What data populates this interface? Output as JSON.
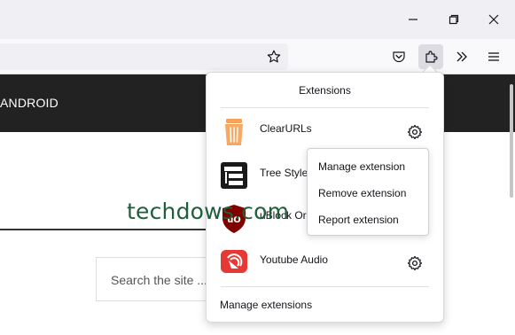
{
  "window": {
    "minimize_icon": "minimize-icon",
    "maximize_icon": "restore-icon",
    "close_icon": "close-icon"
  },
  "toolbar": {
    "bookmark_icon": "star-icon",
    "pocket_icon": "pocket-icon",
    "extensions_icon": "puzzle-icon",
    "overflow_icon": "double-chevron-icon",
    "menu_icon": "hamburger-icon"
  },
  "site": {
    "nav_item": "ANDROID",
    "logo": "techdows.com",
    "search_placeholder": "Search the site ..."
  },
  "extensions_panel": {
    "title": "Extensions",
    "items": [
      {
        "name": "ClearURLs",
        "icon": "trash-can-icon",
        "icon_color": "#f4a460"
      },
      {
        "name": "Tree Style T",
        "icon": "tree-tabs-icon",
        "icon_color": "#1a1a1a"
      },
      {
        "name": "uBlock Ori",
        "icon": "ublock-shield-icon",
        "icon_color": "#800000"
      },
      {
        "name": "Youtube Audio",
        "icon": "youtube-audio-icon",
        "icon_color": "#e53935"
      }
    ],
    "footer": "Manage extensions"
  },
  "context_menu": {
    "items": [
      "Manage extension",
      "Remove extension",
      "Report extension"
    ]
  },
  "colors": {
    "accent_nav": "#222222",
    "logo_green": "#1f5f3a"
  }
}
